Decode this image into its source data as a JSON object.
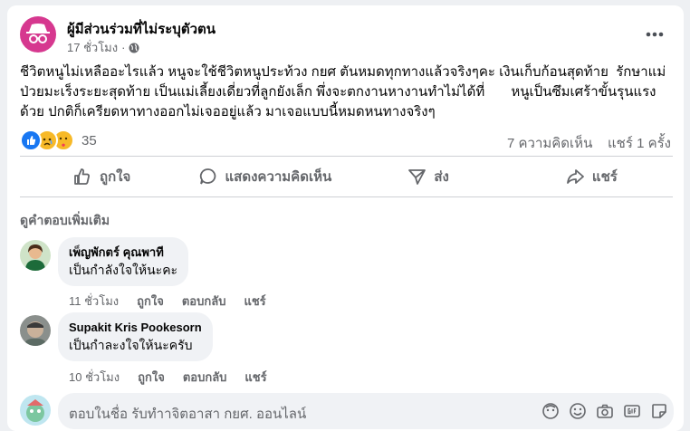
{
  "post": {
    "author": "ผู้มีส่วนร่วมที่ไม่ระบุตัวตน",
    "time": "17 ชั่วโมง",
    "text": "ชีวิตหนูไม่เหลืออะไรแล้ว หนูจะใช้ชีวิตหนูประท้วง กยศ ตันหมดทุกทางแล้วจริงๆคะ เงินเก็บก้อนสุดท้าย  รักษาแม่ป่วยมะเร็งระยะสุดท้าย เป็นแม่เลี้ยงเดี่ยวที่ลูกยังเล็ก พึ่งจะตกงานหางานทำไม่ได้ที่       หนูเป็นซึมเศร้าขั้นรุนแรงด้วย ปกติก็เครียดหาทางออกไม่เจออยู่แล้ว มาเจอแบบนี้หมดหนทางจริงๆ",
    "reaction_count": "35",
    "comments_count": "7 ความคิดเห็น",
    "shares_count": "แชร์ 1 ครั้ง"
  },
  "actions": {
    "like": "ถูกใจ",
    "comment": "แสดงความคิดเห็น",
    "send": "ส่ง",
    "share": "แชร์"
  },
  "more_comments": "ดูคำตอบเพิ่มเติม",
  "comments": [
    {
      "name": "เพ็ญพักตร์ คุณพาที",
      "text": "เป็นกำลังใจให้นะคะ",
      "time": "11 ชั่วโมง",
      "like": "ถูกใจ",
      "reply": "ตอบกลับ",
      "share": "แชร์"
    },
    {
      "name": "Supakit Kris Pookesorn",
      "text": "เป็นกำละงใจให้นะครับ",
      "time": "10 ชั่วโมง",
      "like": "ถูกใจ",
      "reply": "ตอบกลับ",
      "share": "แชร์"
    }
  ],
  "reply": {
    "placeholder": "ตอบในชื่อ รับทำาจิตอาสา กยศ. ออนไลน์"
  },
  "colors": {
    "anonymous_avatar": "#d6388f",
    "like_blue": "#1877f2"
  }
}
